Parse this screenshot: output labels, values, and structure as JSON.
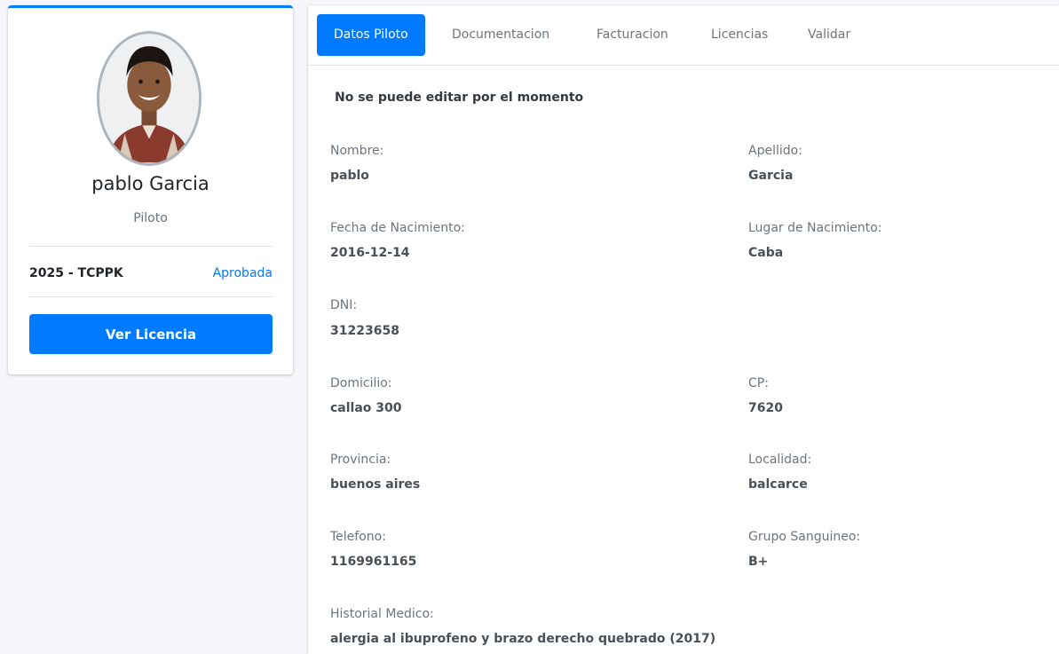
{
  "profile": {
    "name": "pablo Garcia",
    "role": "Piloto",
    "license_code": "2025 - TCPPK",
    "license_status": "Aprobada",
    "view_license_label": "Ver Licencia"
  },
  "tabs": [
    {
      "label": "Datos Piloto",
      "active": true
    },
    {
      "label": "Documentacion",
      "active": false
    },
    {
      "label": "Facturacion",
      "active": false
    },
    {
      "label": "Licencias",
      "active": false
    },
    {
      "label": "Validar",
      "active": false
    }
  ],
  "notice": "No se puede editar por el momento",
  "fields": {
    "nombre": {
      "label": "Nombre:",
      "value": "pablo"
    },
    "apellido": {
      "label": "Apellido:",
      "value": "Garcia"
    },
    "fecha_nacimiento": {
      "label": "Fecha de Nacimiento:",
      "value": "2016-12-14"
    },
    "lugar_nacimiento": {
      "label": "Lugar de Nacimiento:",
      "value": "Caba"
    },
    "dni": {
      "label": "DNI:",
      "value": "31223658"
    },
    "domicilio": {
      "label": "Domicilio:",
      "value": "callao 300"
    },
    "cp": {
      "label": "CP:",
      "value": "7620"
    },
    "provincia": {
      "label": "Provincia:",
      "value": "buenos aires"
    },
    "localidad": {
      "label": "Localidad:",
      "value": "balcarce"
    },
    "telefono": {
      "label": "Telefono:",
      "value": "1169961165"
    },
    "grupo_sanguineo": {
      "label": "Grupo Sanguineo:",
      "value": "B+"
    },
    "historial_medico": {
      "label": "Historial Medico:",
      "value": "alergia al ibuprofeno y brazo derecho quebrado (2017)"
    }
  },
  "colors": {
    "primary": "#007bff",
    "muted": "#6c757d"
  }
}
